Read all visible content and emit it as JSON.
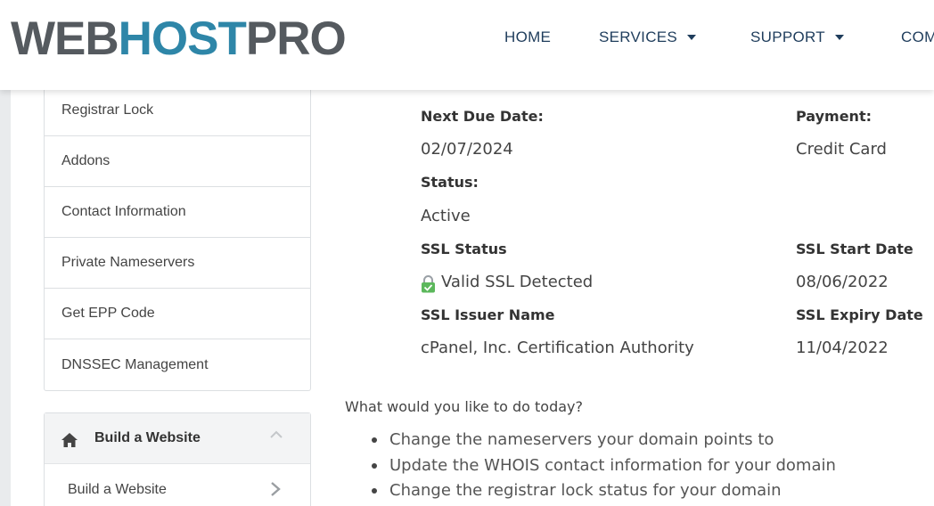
{
  "header": {
    "logo": {
      "part1": "WEB",
      "part2": "HOST",
      "part3": "PRO"
    },
    "nav": [
      {
        "label": "HOME"
      },
      {
        "label": "SERVICES"
      },
      {
        "label": "SUPPORT"
      },
      {
        "label": "COM"
      }
    ]
  },
  "sidebar": {
    "items": [
      {
        "label": "Registrar Lock"
      },
      {
        "label": "Addons"
      },
      {
        "label": "Contact Information"
      },
      {
        "label": "Private Nameservers"
      },
      {
        "label": "Get EPP Code"
      },
      {
        "label": "DNSSEC Management"
      }
    ],
    "build_panel": {
      "title": "Build a Website",
      "icon": "home-icon",
      "items": [
        {
          "label": "Build a Website"
        }
      ]
    }
  },
  "details": {
    "next_due_date": {
      "label": "Next Due Date:",
      "value": "02/07/2024"
    },
    "payment": {
      "label": "Payment:",
      "value": "Credit Card"
    },
    "status": {
      "label": "Status:",
      "value": "Active"
    },
    "ssl_status": {
      "label": "SSL Status",
      "value": "Valid SSL Detected",
      "icon": "lock-icon"
    },
    "ssl_start_date": {
      "label": "SSL Start Date",
      "value": "08/06/2022"
    },
    "ssl_issuer": {
      "label": "SSL Issuer Name",
      "value": "cPanel, Inc. Certification Authority"
    },
    "ssl_expiry_date": {
      "label": "SSL Expiry Date",
      "value": "11/04/2022"
    }
  },
  "actions": {
    "question": "What would you like to do today?",
    "items": [
      "Change the nameservers your domain points to",
      "Update the WHOIS contact information for your domain",
      "Change the registrar lock status for your domain"
    ]
  },
  "colors": {
    "brand_gray": "#555a5f",
    "brand_blue": "#2e86a8",
    "nav_text": "#1f3d5c",
    "ssl_green": "#5cb85c"
  }
}
